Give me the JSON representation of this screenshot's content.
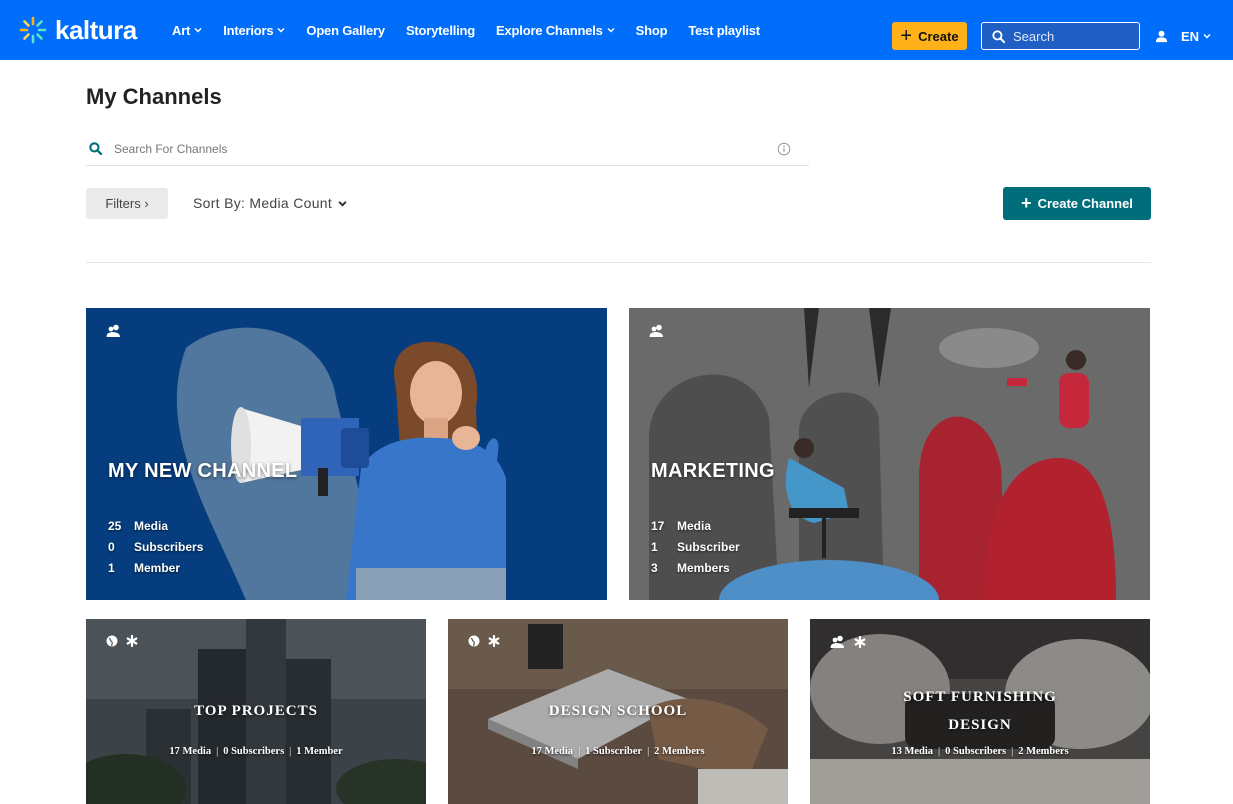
{
  "brand": {
    "name": "kaltura",
    "nav_color": "#006efa",
    "accent": "#ffb11a",
    "teal": "#006d7a"
  },
  "nav": {
    "items": [
      {
        "label": "Art",
        "dropdown": true
      },
      {
        "label": "Interiors",
        "dropdown": true
      },
      {
        "label": "Open Gallery",
        "dropdown": false
      },
      {
        "label": "Storytelling",
        "dropdown": false
      },
      {
        "label": "Explore Channels",
        "dropdown": true
      },
      {
        "label": "Shop",
        "dropdown": false
      },
      {
        "label": "Test playlist",
        "dropdown": false
      }
    ],
    "create_label": "Create",
    "search_placeholder": "Search",
    "language": "EN"
  },
  "page": {
    "title": "My Channels",
    "search_placeholder": "Search For Channels",
    "filters_label": "Filters ›",
    "sort_label": "Sort By: Media Count",
    "create_channel_label": "Create Channel"
  },
  "channels": [
    {
      "name": "MY NEW CHANNEL",
      "media": "25",
      "media_label": "Media",
      "subscribers": "0",
      "subscribers_label": "Subscribers",
      "members": "1",
      "members_label": "Member",
      "icons": [
        "group-icon"
      ]
    },
    {
      "name": "MARKETING",
      "media": "17",
      "media_label": "Media",
      "subscribers": "1",
      "subscribers_label": "Subscriber",
      "members": "3",
      "members_label": "Members",
      "icons": [
        "group-icon"
      ]
    },
    {
      "name": "TOP PROJECTS",
      "stats": "17 Media",
      "stats2": "0 Subscribers",
      "stats3": "1 Member",
      "icons": [
        "globe-icon",
        "asterisk-icon"
      ]
    },
    {
      "name": "DESIGN SCHOOL",
      "stats": "17 Media",
      "stats2": "1 Subscriber",
      "stats3": "2 Members",
      "icons": [
        "globe-icon",
        "asterisk-icon"
      ]
    },
    {
      "name_line1": "SOFT FURNISHING",
      "name_line2": "DESIGN",
      "stats": "13 Media",
      "stats2": "0 Subscribers",
      "stats3": "2 Members",
      "icons": [
        "group-icon",
        "asterisk-icon"
      ]
    }
  ]
}
